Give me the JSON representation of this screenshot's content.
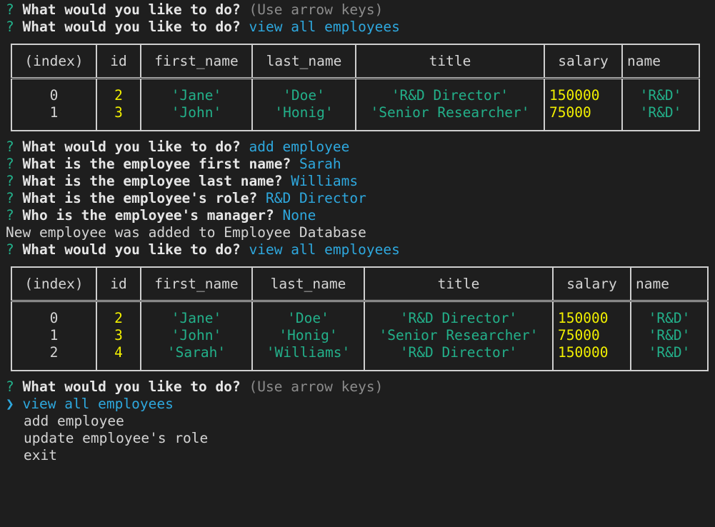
{
  "prompt_question": "What would you like to do?",
  "hint": "(Use arrow keys)",
  "history": {
    "l1": {
      "q": "?",
      "text": "What would you like to do?",
      "hint": "(Use arrow keys)"
    },
    "l2": {
      "q": "?",
      "text": "What would you like to do?",
      "answer": "view all employees"
    }
  },
  "table1": {
    "headers": [
      "(index)",
      "id",
      "first_name",
      "last_name",
      "title",
      "salary",
      "name"
    ],
    "col": {
      "index": "0\n1",
      "id": "2\n3",
      "first_name": "'Jane'\n'John'",
      "last_name": "'Doe'\n'Honig'",
      "title": "'R&D Director'\n'Senior Researcher'",
      "salary": "150000\n75000",
      "name": "'R&D'\n'R&D'"
    }
  },
  "session": {
    "l3": {
      "q": "?",
      "text": "What would you like to do?",
      "answer": "add employee"
    },
    "l4": {
      "q": "?",
      "text": "What is the employee first name?",
      "answer": "Sarah"
    },
    "l5": {
      "q": "?",
      "text": "What is the employee last name?",
      "answer": "Williams"
    },
    "l6": {
      "q": "?",
      "text": "What is the employee's role?",
      "answer": "R&D Director"
    },
    "l7": {
      "q": "?",
      "text": "Who is the employee's manager?",
      "answer": "None"
    },
    "l8": {
      "text": "New employee was added to Employee Database"
    },
    "l9": {
      "q": "?",
      "text": "What would you like to do?",
      "answer": "view all employees"
    }
  },
  "table2": {
    "headers": [
      "(index)",
      "id",
      "first_name",
      "last_name",
      "title",
      "salary",
      "name"
    ],
    "col": {
      "index": "0\n1\n2",
      "id": "2\n3\n4",
      "first_name": "'Jane'\n'John'\n'Sarah'",
      "last_name": "'Doe'\n'Honig'\n'Williams'",
      "title": "'R&D Director'\n'Senior Researcher'\n'R&D Director'",
      "salary": "150000\n75000\n150000",
      "name": "'R&D'\n'R&D'\n'R&D'"
    }
  },
  "menu": {
    "prompt": {
      "q": "?",
      "text": "What would you like to do?",
      "hint": "(Use arrow keys)"
    },
    "pointer": "❯",
    "items": [
      "view all employees",
      "add employee",
      "update employee's role",
      "exit"
    ]
  }
}
